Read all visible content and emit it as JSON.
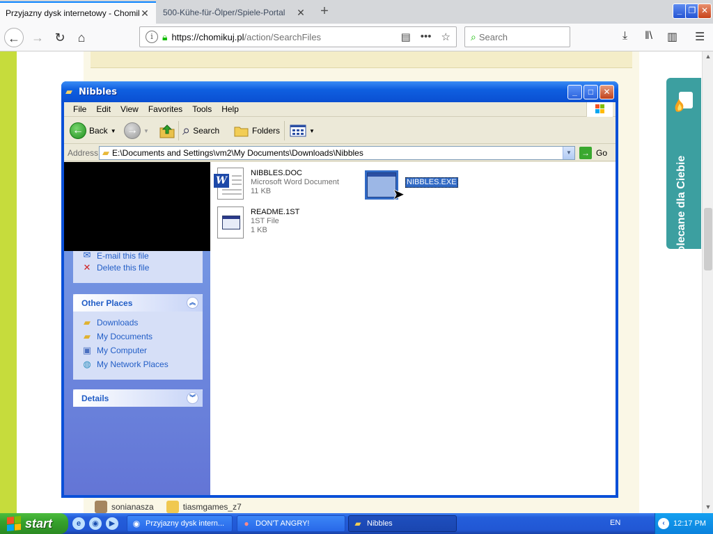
{
  "browser": {
    "tabs": [
      {
        "title": "Przyjazny dysk internetowy - Chomikuj",
        "active": true
      },
      {
        "title": "500-Kühe-für-Ölper/Spiele-Portal",
        "active": false
      }
    ],
    "url": {
      "host": "https://chomikuj.pl",
      "path": "/action/SearchFiles"
    },
    "search_placeholder": "Search"
  },
  "page": {
    "promo_text": "Polecane dla Ciebie",
    "users": [
      "sonianasza",
      "tiasmgames_z7"
    ]
  },
  "explorer": {
    "title": "Nibbles",
    "menu": [
      "File",
      "Edit",
      "View",
      "Favorites",
      "Tools",
      "Help"
    ],
    "toolbar": {
      "back": "Back",
      "search": "Search",
      "folders": "Folders"
    },
    "address_label": "Address",
    "address_path": "E:\\Documents and Settings\\vm2\\My Documents\\Downloads\\Nibbles",
    "go_label": "Go",
    "file_tasks": {
      "partial_item": "E-mail this file",
      "delete": "Delete this file"
    },
    "other_places": {
      "title": "Other Places",
      "items": [
        "Downloads",
        "My Documents",
        "My Computer",
        "My Network Places"
      ]
    },
    "details_title": "Details",
    "files": [
      {
        "name": "NIBBLES.DOC",
        "type": "Microsoft Word Document",
        "size": "11 KB"
      },
      {
        "name": "NIBBLES.EXE"
      },
      {
        "name": "README.1ST",
        "type": "1ST File",
        "size": "1 KB"
      }
    ]
  },
  "taskbar": {
    "start": "start",
    "tasks": [
      "Przyjazny dysk intern...",
      "DON'T ANGRY!",
      "Nibbles"
    ],
    "language": "EN",
    "clock": "12:17 PM"
  }
}
